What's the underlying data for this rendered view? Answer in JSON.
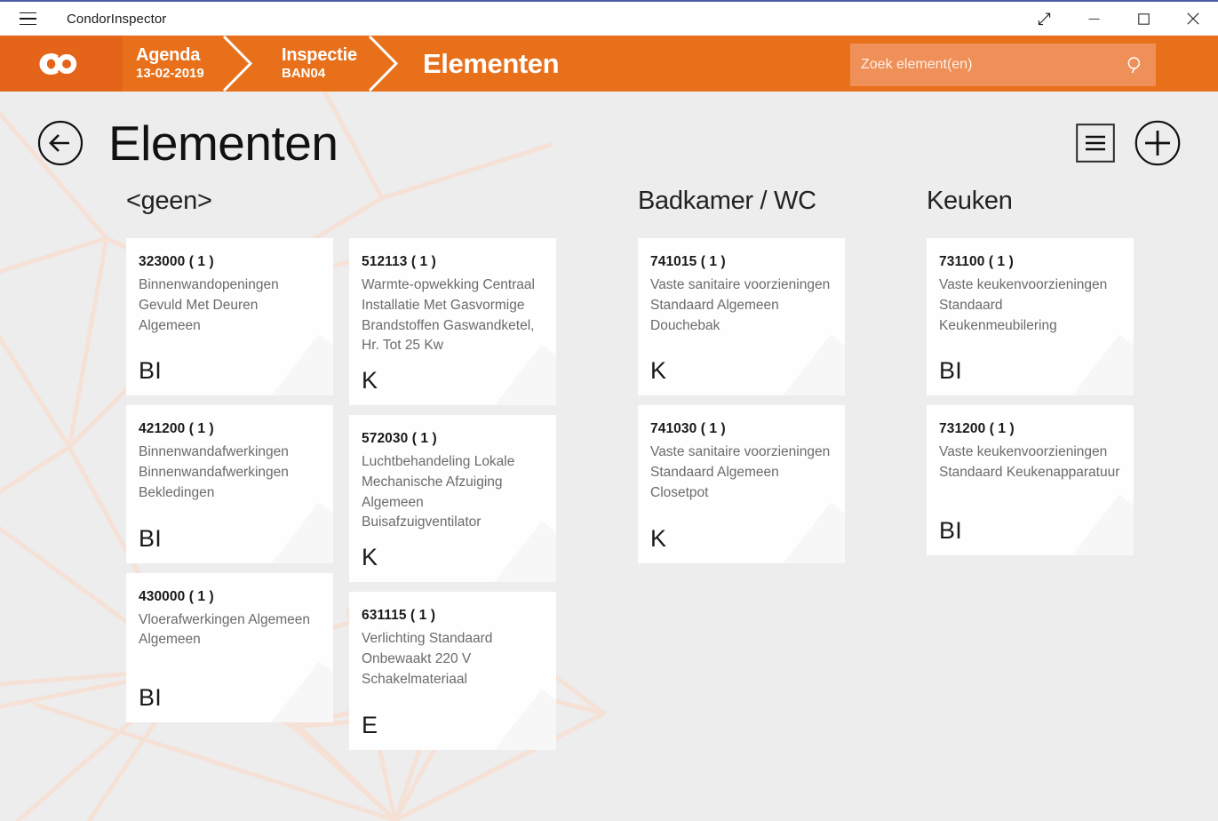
{
  "window": {
    "app_title": "CondorInspector",
    "menu_icon": "hamburger-icon",
    "controls": [
      {
        "name": "restore-diagonal-button",
        "icon": "expand-diagonal-icon",
        "label": "⤡"
      },
      {
        "name": "minimize-button",
        "icon": "minimize-icon",
        "label": "—"
      },
      {
        "name": "maximize-button",
        "icon": "maximize-icon",
        "label": "□"
      },
      {
        "name": "close-button",
        "icon": "close-icon",
        "label": "✕"
      }
    ]
  },
  "colors": {
    "brand_orange": "#e8701a",
    "brand_orange_dark": "#e4641a",
    "search_field": "#ef9059",
    "page_background": "#ededed",
    "card_background": "#fefefe",
    "watermark_line": "#f7e2d8",
    "titlebar_accent": "#4a5fa8"
  },
  "breadcrumb": {
    "logo": "condor-logo",
    "items": [
      {
        "title": "Agenda",
        "subtitle": "13-02-2019"
      },
      {
        "title": "Inspectie",
        "subtitle": "BAN04"
      }
    ],
    "current": "Elementen"
  },
  "search": {
    "placeholder": "Zoek element(en)",
    "value": "",
    "icon": "search-icon"
  },
  "page": {
    "back_icon": "back-arrow-icon",
    "title": "Elementen",
    "actions": [
      {
        "name": "list-view-button",
        "icon": "list-lines-icon"
      },
      {
        "name": "add-element-button",
        "icon": "plus-circle-icon"
      }
    ]
  },
  "columns": [
    {
      "title": "<geen>",
      "cards": [
        {
          "code": "323000",
          "count": "( 1 )",
          "description": [
            "Binnenwandopeningen",
            "Gevuld Met Deuren",
            "Algemeen"
          ],
          "tag": "BI"
        },
        {
          "code": "421200",
          "count": "( 1 )",
          "description": [
            "Binnenwandafwerkingen",
            "Binnenwandafwerkingen",
            "Bekledingen"
          ],
          "tag": "BI"
        },
        {
          "code": "430000",
          "count": "( 1 )",
          "description": [
            "Vloerafwerkingen Algemeen",
            "Algemeen"
          ],
          "tag": "BI"
        }
      ]
    },
    {
      "title": "",
      "cards": [
        {
          "code": "512113",
          "count": "( 1 )",
          "description": [
            "Warmte-opwekking Centraal",
            "Installatie Met Gasvormige",
            "Brandstoffen Gaswandketel,",
            "Hr. Tot 25 Kw"
          ],
          "tag": "K"
        },
        {
          "code": "572030",
          "count": "( 1 )",
          "description": [
            "Luchtbehandeling Lokale",
            "Mechanische Afzuiging",
            "Algemeen",
            "Buisafzuigventilator"
          ],
          "tag": "K"
        },
        {
          "code": "631115",
          "count": "( 1 )",
          "description": [
            "Verlichting Standaard",
            "Onbewaakt 220 V",
            "Schakelmateriaal"
          ],
          "tag": "E"
        }
      ]
    },
    {
      "title": "Badkamer / WC",
      "cards": [
        {
          "code": "741015",
          "count": "( 1 )",
          "description": [
            "Vaste sanitaire voorzieningen",
            "Standaard Algemeen",
            "Douchebak"
          ],
          "tag": "K"
        },
        {
          "code": "741030",
          "count": "( 1 )",
          "description": [
            "Vaste sanitaire voorzieningen",
            "Standaard Algemeen",
            "Closetpot"
          ],
          "tag": "K"
        }
      ]
    },
    {
      "title": "Keuken",
      "cards": [
        {
          "code": "731100",
          "count": "( 1 )",
          "description": [
            "Vaste keukenvoorzieningen",
            "Standaard",
            "Keukenmeubilering"
          ],
          "tag": "BI"
        },
        {
          "code": "731200",
          "count": "( 1 )",
          "description": [
            "Vaste keukenvoorzieningen",
            "Standaard Keukenapparatuur"
          ],
          "tag": "BI"
        }
      ]
    }
  ]
}
